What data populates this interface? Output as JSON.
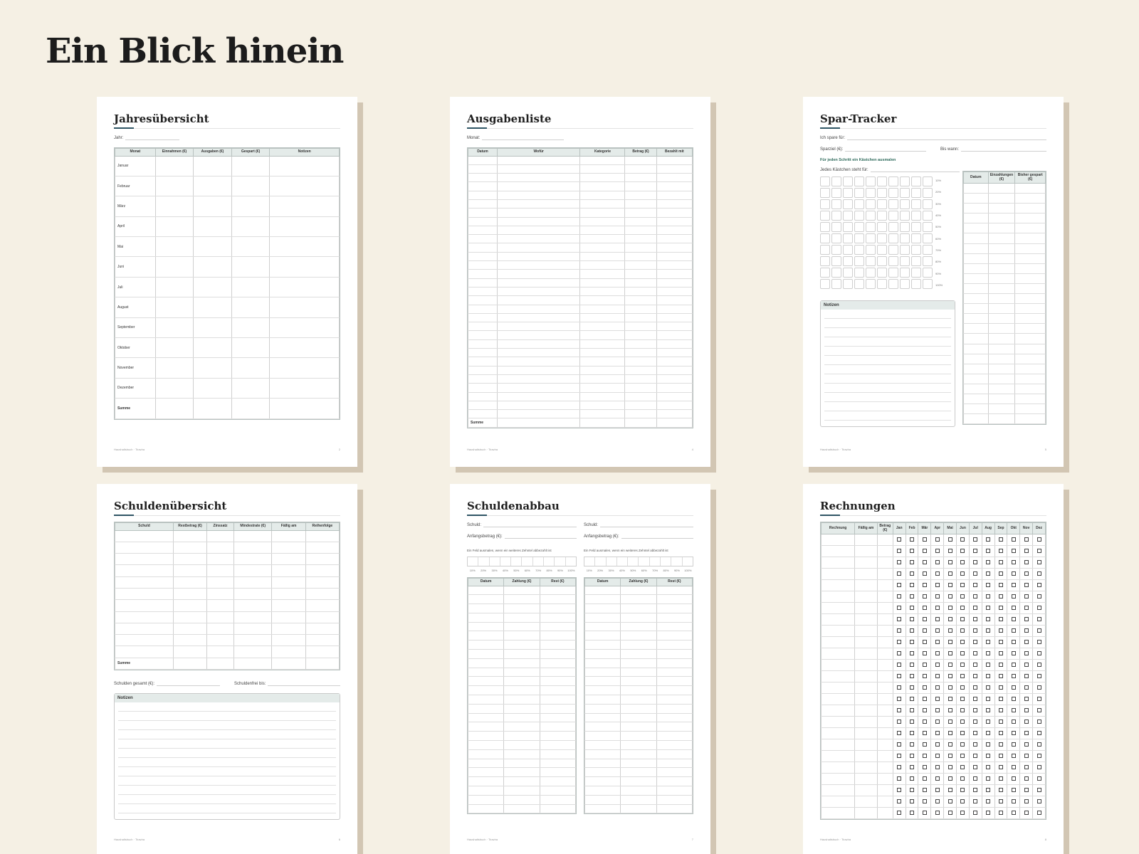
{
  "heading": "Ein Blick hinein",
  "footer_left": "Haushaltsbuch · Tiravira",
  "jahres": {
    "title": "Jahresübersicht",
    "year_label": "Jahr:",
    "columns": [
      "Monat",
      "Einnahmen (€)",
      "Ausgaben (€)",
      "Gespart (€)",
      "Notizen"
    ],
    "months": [
      "Januar",
      "Februar",
      "März",
      "April",
      "Mai",
      "Juni",
      "Juli",
      "August",
      "September",
      "Oktober",
      "November",
      "Dezember"
    ],
    "sum_label": "Summe",
    "page_no": "2"
  },
  "ausgaben": {
    "title": "Ausgabenliste",
    "month_label": "Monat:",
    "columns": [
      "Datum",
      "Wofür",
      "Kategorie",
      "Betrag (€)",
      "Bezahlt mit"
    ],
    "sum_label": "Summe",
    "page_no": "4"
  },
  "spar": {
    "title": "Spar-Tracker",
    "saving_for_label": "Ich spare für:",
    "goal_label": "Sparziel (€):",
    "until_label": "Bis wann:",
    "instruction": "Für jeden Schritt ein Kästchen ausmalen",
    "box_value_label": "Jedes Kästchen steht für:",
    "percents": [
      "10%",
      "20%",
      "30%",
      "40%",
      "50%",
      "60%",
      "70%",
      "80%",
      "90%",
      "100%"
    ],
    "notes_label": "Notizen",
    "columns": [
      "Datum",
      "Einzahlungen (€)",
      "Bisher gespart (€)"
    ],
    "page_no": "5"
  },
  "schulden": {
    "title": "Schuldenübersicht",
    "columns": [
      "Schuld",
      "Restbetrag (€)",
      "Zinssatz",
      "Mindestrate (€)",
      "Fällig am",
      "Reihenfolge"
    ],
    "sum_label": "Summe",
    "total_label": "Schulden gesamt (€):",
    "free_label": "Schuldenfrei bis:",
    "notes_label": "Notizen",
    "page_no": "6"
  },
  "abbau": {
    "title": "Schuldenabbau",
    "debt_label": "Schuld:",
    "start_label": "Anfangsbetrag (€):",
    "instruction": "Ein Feld ausmalen, wenn ein weiteres Zehntel abbezahlt ist",
    "percents": [
      "10%",
      "20%",
      "30%",
      "40%",
      "50%",
      "60%",
      "70%",
      "80%",
      "90%",
      "100%"
    ],
    "columns": [
      "Datum",
      "Zahlung (€)",
      "Rest (€)"
    ],
    "page_no": "7"
  },
  "rechnungen": {
    "title": "Rechnungen",
    "columns": [
      "Rechnung",
      "Fällig am",
      "Betrag (€)"
    ],
    "months": [
      "Jan",
      "Feb",
      "Mär",
      "Apr",
      "Mai",
      "Jun",
      "Jul",
      "Aug",
      "Sep",
      "Okt",
      "Nov",
      "Dez"
    ],
    "page_no": "8"
  }
}
